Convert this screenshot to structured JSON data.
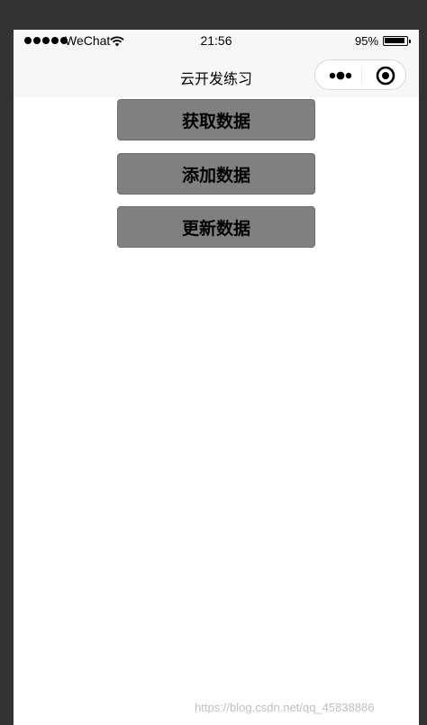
{
  "status_bar": {
    "carrier": "WeChat",
    "time": "21:56",
    "battery_percent_text": "95%",
    "battery_level": 0.95,
    "signal_icon": "signal-dots-icon",
    "wifi_icon": "wifi-icon",
    "battery_icon": "battery-icon"
  },
  "nav_bar": {
    "title": "云开发练习",
    "capsule": {
      "more_icon": "more-dots-icon",
      "close_icon": "target-close-icon"
    }
  },
  "buttons": {
    "get_data": "获取数据",
    "add_data": "添加数据",
    "update_data": "更新数据"
  },
  "watermark": "https://blog.csdn.net/qq_45838886",
  "colors": {
    "outer_background": "#333333",
    "bar_background": "#f7f7f7",
    "button_background": "#808080",
    "page_background": "#ffffff"
  }
}
